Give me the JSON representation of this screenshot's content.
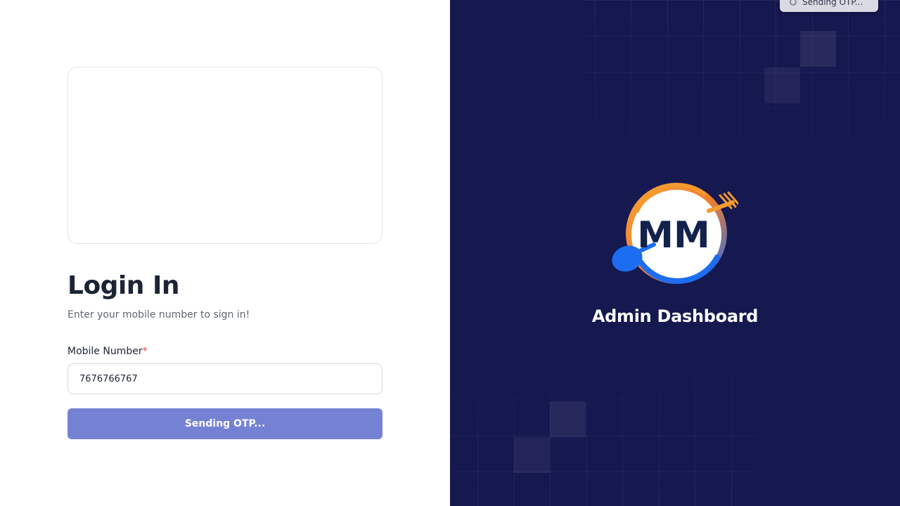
{
  "login": {
    "title": "Login In",
    "subtitle": "Enter your mobile number to sign in!",
    "mobile_label": "Mobile Number",
    "required_marker": "*",
    "mobile_value": "7676766767",
    "submit_label": "Sending OTP..."
  },
  "brand": {
    "logo_text": "MM",
    "title": "Admin Dashboard",
    "colors": {
      "panel_bg": "#161850",
      "accent_orange": "#f39a2e",
      "accent_blue": "#1d6df0",
      "logo_text": "#12224d",
      "button": "#7582d4"
    }
  },
  "toast": {
    "text": "Sending OTP...",
    "icon": "spinner-icon"
  }
}
